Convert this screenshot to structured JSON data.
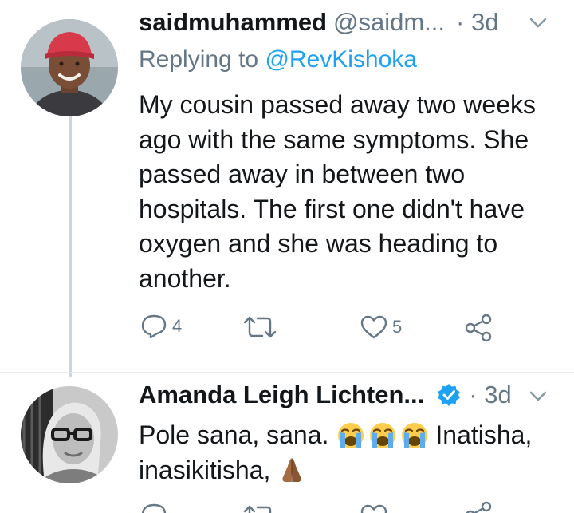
{
  "tweets": [
    {
      "display_name": "saidmuhammed",
      "handle": "@saidm...",
      "time": "· 3d",
      "replying_label": "Replying to",
      "replying_handle": "@RevKishoka",
      "text_lines": [
        "My cousin passed away two weeks",
        "ago with the same symptoms. She",
        "passed away in between two",
        "hospitals. The first one didn't have",
        "oxygen and she was heading to",
        "another."
      ],
      "reply_count": "4",
      "like_count": "5",
      "avatar_icon": "man-with-red-cap-avatar"
    },
    {
      "display_name": "Amanda Leigh Lichten...",
      "time": "· 3d",
      "verified": true,
      "text_line1_prefix": "Pole sana, sana.",
      "text_line1_suffix": "Inatisha,",
      "text_line2": "inasikitisha,",
      "emojis": [
        "loudly-crying-face",
        "loudly-crying-face",
        "loudly-crying-face",
        "folded-hands"
      ],
      "avatar_icon": "woman-with-glasses-avatar"
    }
  ],
  "colors": {
    "accent": "#1da1f2",
    "muted": "#657786",
    "thread_line": "#ccd6dd"
  }
}
